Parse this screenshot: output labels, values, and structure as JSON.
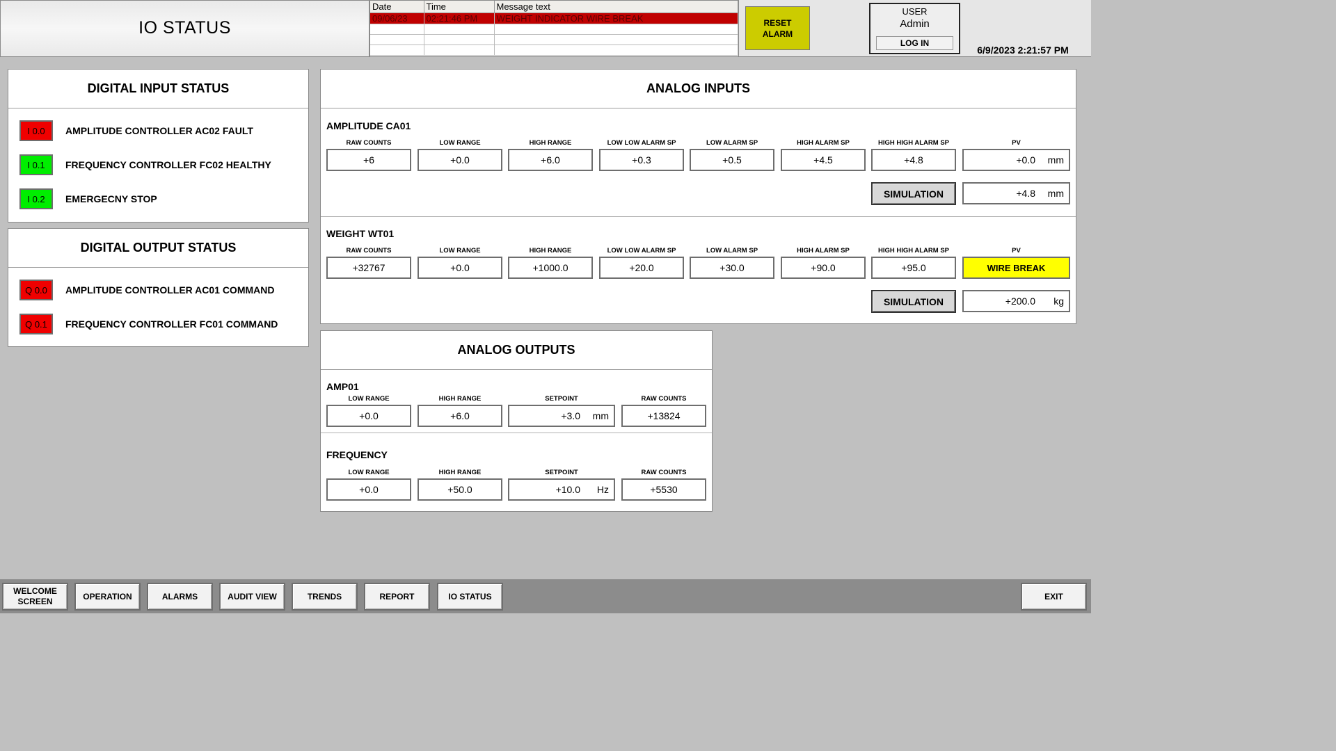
{
  "header": {
    "title": "IO STATUS",
    "alarm_table": {
      "columns": [
        "Date",
        "Time",
        "Message text"
      ],
      "rows": [
        {
          "date": "09/06/23",
          "time": "02:21:46 PM",
          "message": "WEIGHT INDICATOR WIRE BREAK",
          "active": true
        },
        {
          "date": "",
          "time": "",
          "message": "",
          "active": false
        },
        {
          "date": "",
          "time": "",
          "message": "",
          "active": false
        },
        {
          "date": "",
          "time": "",
          "message": "",
          "active": false
        }
      ]
    },
    "reset_alarm": {
      "line1": "RESET",
      "line2": "ALARM"
    },
    "user": {
      "title": "USER",
      "name": "Admin",
      "login_label": "LOG IN"
    },
    "datetime": "6/9/2023 2:21:57 PM"
  },
  "digital_inputs": {
    "title": "DIGITAL INPUT STATUS",
    "items": [
      {
        "tag": "I 0.0",
        "label": "AMPLITUDE CONTROLLER AC02 FAULT",
        "state": "red"
      },
      {
        "tag": "I 0.1",
        "label": "FREQUENCY CONTROLLER FC02 HEALTHY",
        "state": "green"
      },
      {
        "tag": "I 0.2",
        "label": "EMERGECNY STOP",
        "state": "green"
      }
    ]
  },
  "digital_outputs": {
    "title": "DIGITAL OUTPUT STATUS",
    "items": [
      {
        "tag": "Q 0.0",
        "label": "AMPLITUDE CONTROLLER AC01 COMMAND",
        "state": "red"
      },
      {
        "tag": "Q 0.1",
        "label": "FREQUENCY CONTROLLER FC01 COMMAND",
        "state": "red"
      }
    ]
  },
  "analog_inputs": {
    "title": "ANALOG INPUTS",
    "columns": [
      "RAW COUNTS",
      "LOW RANGE",
      "HIGH RANGE",
      "LOW LOW ALARM SP",
      "LOW ALARM SP",
      "HIGH ALARM SP",
      "HIGH HIGH ALARM SP",
      "PV"
    ],
    "amplitude": {
      "name": "AMPLITUDE CA01",
      "raw_counts": "+6",
      "low_range": "+0.0",
      "high_range": "+6.0",
      "low_low_sp": "+0.3",
      "low_sp": "+0.5",
      "high_sp": "+4.5",
      "high_high_sp": "+4.8",
      "pv": "+0.0",
      "pv_unit": "mm",
      "simulation_label": "SIMULATION",
      "sim_value": "+4.8",
      "sim_unit": "mm"
    },
    "weight": {
      "name": "WEIGHT WT01",
      "raw_counts": "+32767",
      "low_range": "+0.0",
      "high_range": "+1000.0",
      "low_low_sp": "+20.0",
      "low_sp": "+30.0",
      "high_sp": "+90.0",
      "high_high_sp": "+95.0",
      "pv": "WIRE BREAK",
      "simulation_label": "SIMULATION",
      "sim_value": "+200.0",
      "sim_unit": "kg"
    }
  },
  "analog_outputs": {
    "title": "ANALOG OUTPUTS",
    "columns": [
      "LOW RANGE",
      "HIGH RANGE",
      "SETPOINT",
      "RAW COUNTS"
    ],
    "amp": {
      "name": "AMP01",
      "low_range": "+0.0",
      "high_range": "+6.0",
      "setpoint": "+3.0",
      "unit": "mm",
      "raw_counts": "+13824"
    },
    "frequency": {
      "name": "FREQUENCY",
      "low_range": "+0.0",
      "high_range": "+50.0",
      "setpoint": "+10.0",
      "unit": "Hz",
      "raw_counts": "+5530"
    }
  },
  "nav": {
    "welcome_line1": "WELCOME",
    "welcome_line2": "SCREEN",
    "operation": "OPERATION",
    "alarms": "ALARMS",
    "audit_view": "AUDIT VIEW",
    "trends": "TRENDS",
    "report": "REPORT",
    "io_status": "IO STATUS",
    "exit": "EXIT"
  },
  "colors": {
    "alarm_row": "#c00000",
    "led_red": "#f00000",
    "led_green": "#00ee00",
    "wire_break": "#ffff00",
    "reset_button": "#cccc00"
  }
}
